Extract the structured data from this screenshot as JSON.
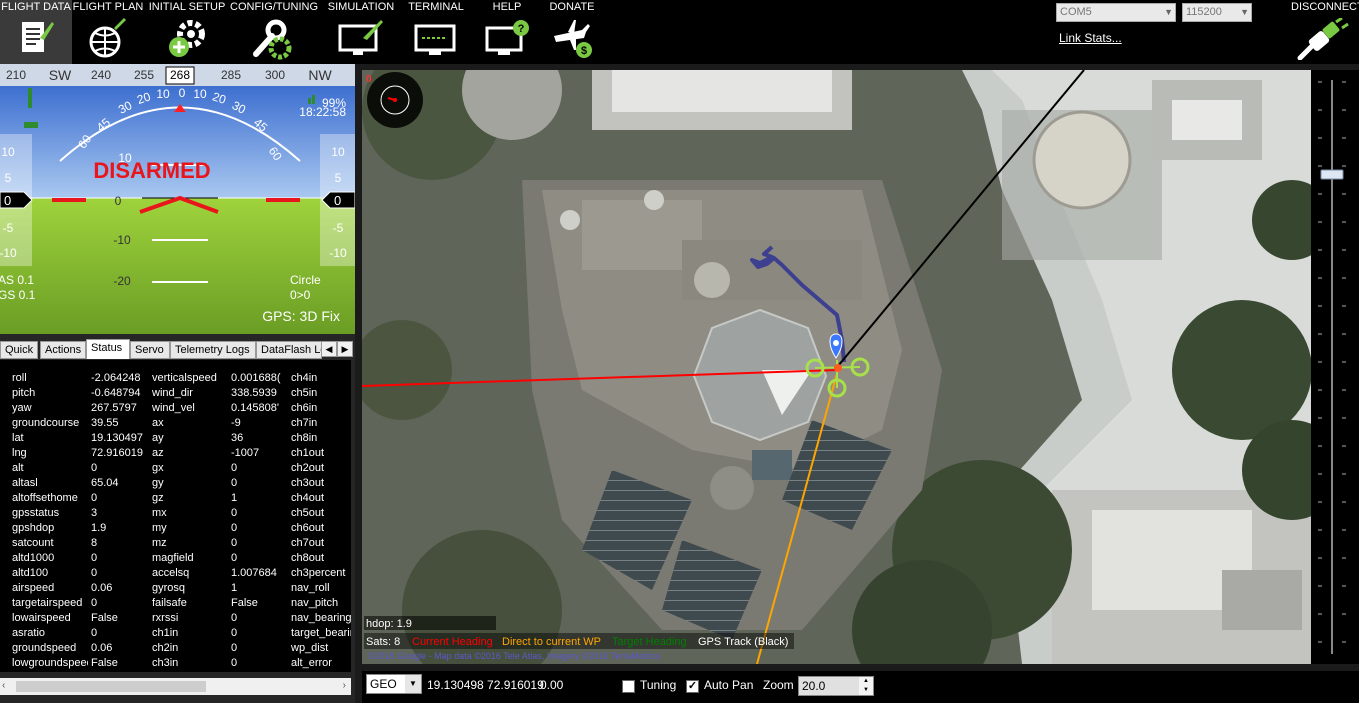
{
  "menu": [
    {
      "label": "FLIGHT DATA",
      "icon": "flight-data-icon"
    },
    {
      "label": "FLIGHT PLAN",
      "icon": "flight-plan-icon"
    },
    {
      "label": "INITIAL SETUP",
      "icon": "initial-setup-icon"
    },
    {
      "label": "CONFIG/TUNING",
      "icon": "config-tuning-icon"
    },
    {
      "label": "SIMULATION",
      "icon": "simulation-icon"
    },
    {
      "label": "TERMINAL",
      "icon": "terminal-icon"
    },
    {
      "label": "HELP",
      "icon": "help-icon"
    },
    {
      "label": "DONATE",
      "icon": "donate-icon"
    }
  ],
  "connection": {
    "port": "COM5",
    "baud": "115200",
    "link_stats": "Link Stats...",
    "disconnect": "DISCONNECT"
  },
  "hud": {
    "compass_ticks": [
      "210",
      "SW",
      "240",
      "255",
      "268",
      "285",
      "300",
      "NW"
    ],
    "pitch_labels": {
      "p10": "10",
      "p0": "0",
      "m10": "-10",
      "m20": "-20"
    },
    "roll_ticks": [
      "60",
      "45",
      "30",
      "20",
      "10",
      "0",
      "10",
      "20",
      "30",
      "45",
      "60"
    ],
    "left_tape": [
      "10",
      "5",
      "0",
      "-5",
      "-10"
    ],
    "right_tape": [
      "10",
      "5",
      "0",
      "-5",
      "-10"
    ],
    "speed_value": "0",
    "alt_value": "0",
    "armed_state": "DISARMED",
    "battery": "99%",
    "time": "18:22:58",
    "as": "AS 0.1",
    "gs": "GS 0.1",
    "mode": "Circle",
    "wp": "0>0",
    "gps": "GPS: 3D Fix",
    "colors": {
      "disarmed": "#e8161c",
      "sky": "#6fa0d8",
      "ground": "#7cb82f"
    }
  },
  "tabs": [
    "Quick",
    "Actions",
    "Status",
    "Servo",
    "Telemetry Logs",
    "DataFlash Lo"
  ],
  "active_tab": "Status",
  "status": [
    [
      [
        "roll",
        "-2.064248"
      ],
      [
        "verticalspeed",
        "0.001688("
      ],
      [
        "ch4in",
        ""
      ]
    ],
    [
      [
        "pitch",
        "-0.648794"
      ],
      [
        "wind_dir",
        "338.5939"
      ],
      [
        "ch5in",
        ""
      ]
    ],
    [
      [
        "yaw",
        "267.5797"
      ],
      [
        "wind_vel",
        "0.145808'"
      ],
      [
        "ch6in",
        ""
      ]
    ],
    [
      [
        "groundcourse",
        "39.55"
      ],
      [
        "ax",
        "-9"
      ],
      [
        "ch7in",
        ""
      ]
    ],
    [
      [
        "lat",
        "19.130497"
      ],
      [
        "ay",
        "36"
      ],
      [
        "ch8in",
        ""
      ]
    ],
    [
      [
        "lng",
        "72.916019"
      ],
      [
        "az",
        "-1007"
      ],
      [
        "ch1out",
        ""
      ]
    ],
    [
      [
        "alt",
        "0"
      ],
      [
        "gx",
        "0"
      ],
      [
        "ch2out",
        ""
      ]
    ],
    [
      [
        "altasl",
        "65.04"
      ],
      [
        "gy",
        "0"
      ],
      [
        "ch3out",
        ""
      ]
    ],
    [
      [
        "altoffsethome",
        "0"
      ],
      [
        "gz",
        "1"
      ],
      [
        "ch4out",
        ""
      ]
    ],
    [
      [
        "gpsstatus",
        "3"
      ],
      [
        "mx",
        "0"
      ],
      [
        "ch5out",
        ""
      ]
    ],
    [
      [
        "gpshdop",
        "1.9"
      ],
      [
        "my",
        "0"
      ],
      [
        "ch6out",
        ""
      ]
    ],
    [
      [
        "satcount",
        "8"
      ],
      [
        "mz",
        "0"
      ],
      [
        "ch7out",
        ""
      ]
    ],
    [
      [
        "altd1000",
        "0"
      ],
      [
        "magfield",
        "0"
      ],
      [
        "ch8out",
        ""
      ]
    ],
    [
      [
        "altd100",
        "0"
      ],
      [
        "accelsq",
        "1.007684"
      ],
      [
        "ch3percent",
        ""
      ]
    ],
    [
      [
        "airspeed",
        "0.06"
      ],
      [
        "gyrosq",
        "1"
      ],
      [
        "nav_roll",
        ""
      ]
    ],
    [
      [
        "targetairspeed",
        "0"
      ],
      [
        "failsafe",
        "False"
      ],
      [
        "nav_pitch",
        ""
      ]
    ],
    [
      [
        "lowairspeed",
        "False"
      ],
      [
        "rxrssi",
        "0"
      ],
      [
        "nav_bearing",
        ""
      ]
    ],
    [
      [
        "asratio",
        "0"
      ],
      [
        "ch1in",
        "0"
      ],
      [
        "target_bearing",
        ""
      ]
    ],
    [
      [
        "groundspeed",
        "0.06"
      ],
      [
        "ch2in",
        "0"
      ],
      [
        "wp_dist",
        ""
      ]
    ],
    [
      [
        "lowgroundspeed",
        "False"
      ],
      [
        "ch3in",
        "0"
      ],
      [
        "alt_error",
        ""
      ]
    ]
  ],
  "map": {
    "minicompass": "0",
    "hdop": "hdop: 1.9",
    "sats": "Sats: 8",
    "legend": [
      {
        "label": "Current Heading",
        "color": "#ff0000"
      },
      {
        "label": "Direct to current WP",
        "color": "#ffa500"
      },
      {
        "label": "Target Heading",
        "color": "#008000"
      },
      {
        "label": "GPS Track (Black)",
        "color": "#ffffff"
      }
    ],
    "copyright": "©2016 Google - Map data ©2016 Tele Atlas, Imagery ©2016 TerraMetrics"
  },
  "bottom": {
    "geo": "GEO",
    "coords": "19.130498 72.916019",
    "alt": "0.00",
    "tuning_label": "Tuning",
    "tuning_checked": false,
    "autopan_label": "Auto Pan",
    "autopan_checked": true,
    "zoom_label": "Zoom",
    "zoom_value": "20.0"
  }
}
